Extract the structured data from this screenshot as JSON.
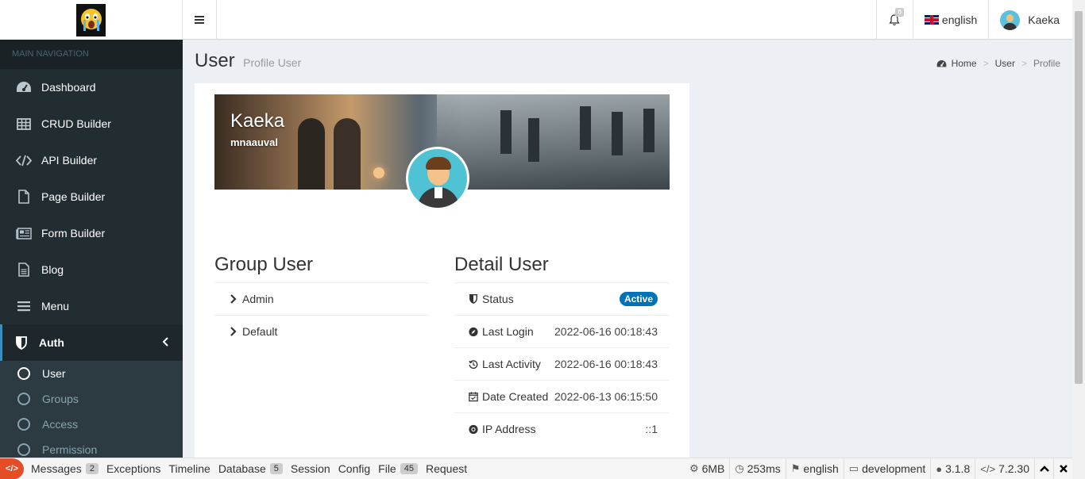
{
  "header": {
    "notifications_count": "0",
    "language": "english",
    "user_name": "Kaeka"
  },
  "sidebar": {
    "section_label": "MAIN NAVIGATION",
    "items": [
      {
        "label": "Dashboard",
        "icon": "dashboard-icon"
      },
      {
        "label": "CRUD Builder",
        "icon": "table-icon"
      },
      {
        "label": "API Builder",
        "icon": "code-icon"
      },
      {
        "label": "Page Builder",
        "icon": "file-icon"
      },
      {
        "label": "Form Builder",
        "icon": "newspaper-icon"
      },
      {
        "label": "Blog",
        "icon": "file-text-icon"
      },
      {
        "label": "Menu",
        "icon": "bars-icon"
      },
      {
        "label": "Auth",
        "icon": "shield-icon"
      }
    ],
    "auth_submenu": [
      {
        "label": "User"
      },
      {
        "label": "Groups"
      },
      {
        "label": "Access"
      },
      {
        "label": "Permission"
      }
    ]
  },
  "page": {
    "title": "User",
    "subtitle": "Profile User",
    "breadcrumb": [
      "Home",
      "User",
      "Profile"
    ]
  },
  "profile": {
    "full_name": "Kaeka",
    "username": "mnaauval",
    "group_title": "Group User",
    "groups": [
      "Admin",
      "Default"
    ],
    "detail_title": "Detail User",
    "details": [
      {
        "label": "Status",
        "value": "Active",
        "icon": "shield-icon"
      },
      {
        "label": "Last Login",
        "value": "2022-06-16 00:18:43",
        "icon": "compass-icon"
      },
      {
        "label": "Last Activity",
        "value": "2022-06-16 00:18:43",
        "icon": "history-icon"
      },
      {
        "label": "Date Created",
        "value": "2022-06-13 06:15:50",
        "icon": "calendar-check-icon"
      },
      {
        "label": "IP Address",
        "value": "::1",
        "icon": "chrome-icon"
      }
    ]
  },
  "debugbar": {
    "tabs": [
      {
        "label": "Messages",
        "count": "2"
      },
      {
        "label": "Exceptions"
      },
      {
        "label": "Timeline"
      },
      {
        "label": "Database",
        "count": "5"
      },
      {
        "label": "Session"
      },
      {
        "label": "Config"
      },
      {
        "label": "File",
        "count": "45"
      },
      {
        "label": "Request"
      }
    ],
    "memory": "6MB",
    "time": "253ms",
    "locale": "english",
    "environment": "development",
    "framework_version": "3.1.8",
    "php_version": "7.2.30"
  },
  "colors": {
    "sidebar_bg": "#222d32",
    "accent": "#3c8dbc",
    "badge_active": "#0073b7",
    "debug_logo": "#e44d26"
  }
}
